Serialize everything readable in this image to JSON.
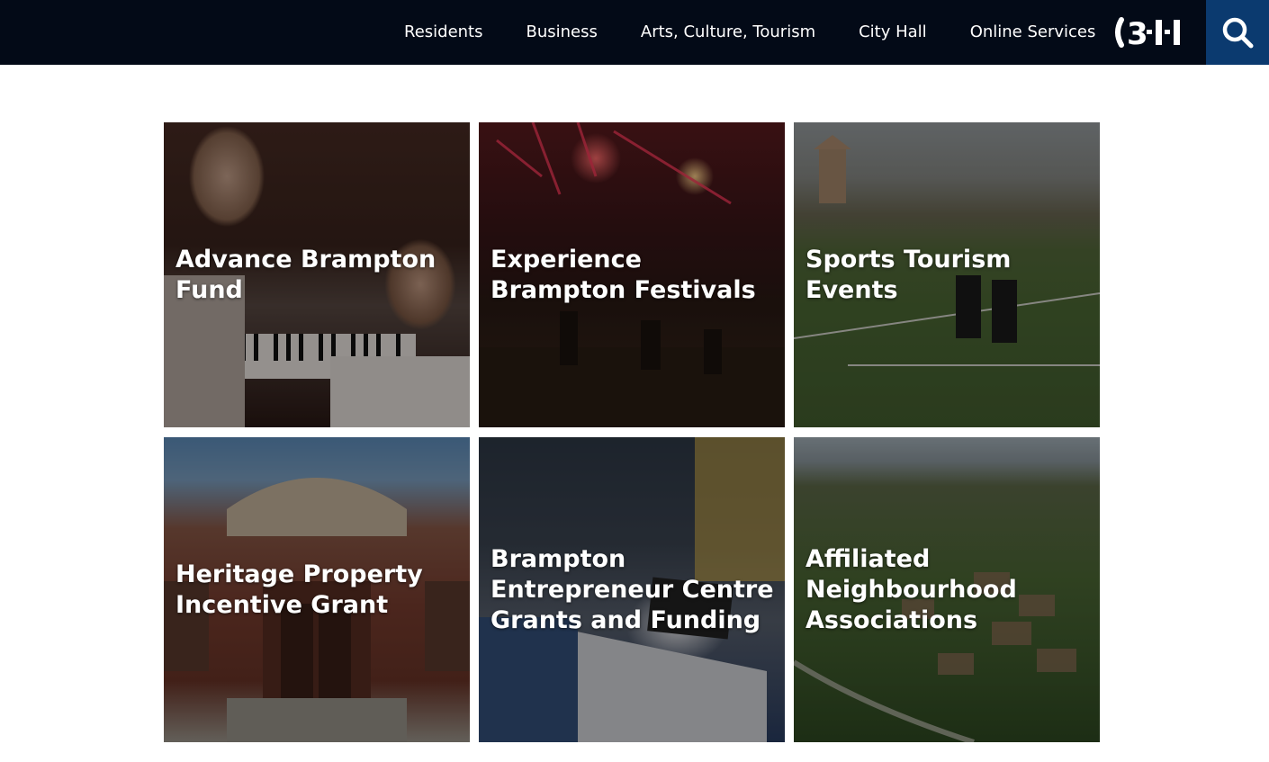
{
  "header": {
    "nav": [
      {
        "label": "Residents"
      },
      {
        "label": "Business"
      },
      {
        "label": "Arts, Culture, Tourism"
      },
      {
        "label": "City Hall"
      },
      {
        "label": "Online Services"
      }
    ],
    "logo_text": "3·1·1",
    "search_icon": "search-icon"
  },
  "tiles": [
    {
      "title": "Advance Brampton Fund"
    },
    {
      "title": "Experience Brampton Festivals"
    },
    {
      "title": "Sports Tourism Events"
    },
    {
      "title": "Heritage Property Incentive Grant"
    },
    {
      "title": "Brampton Entrepreneur Centre Grants and Funding"
    },
    {
      "title": "Affiliated Neighbourhood Associations"
    }
  ],
  "colors": {
    "topbar": "#030a17",
    "search_bg": "#0b3a6f",
    "text": "#ffffff"
  }
}
